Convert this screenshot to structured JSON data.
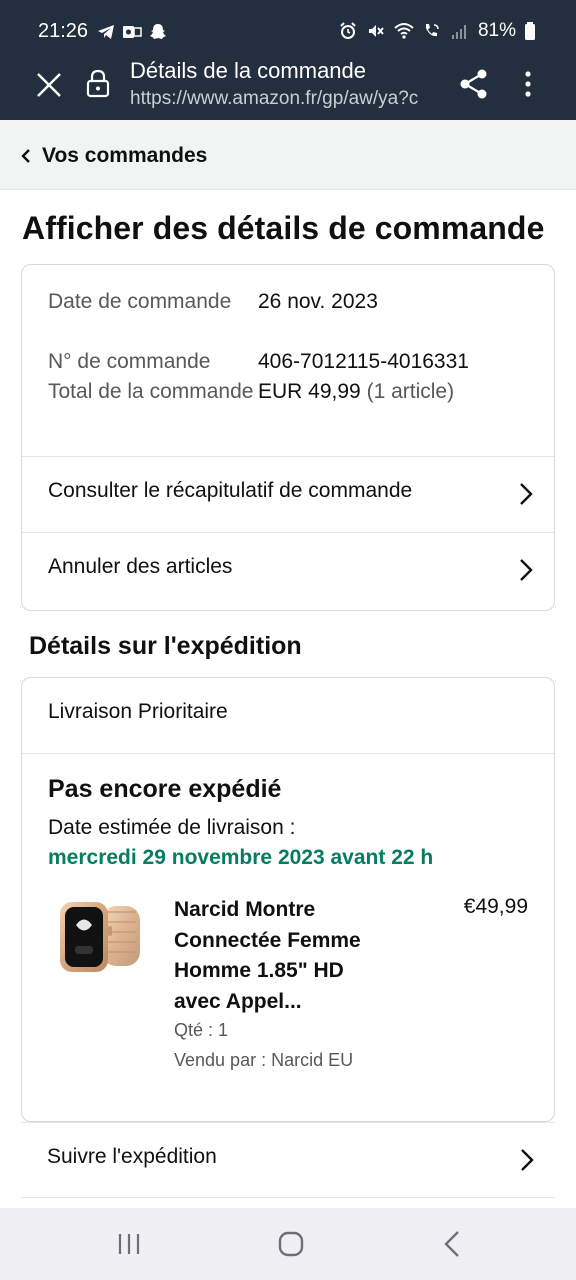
{
  "status_bar": {
    "time": "21:26",
    "battery": "81%"
  },
  "browser": {
    "title": "Détails de la commande",
    "url": "https://www.amazon.fr/gp/aw/ya?c"
  },
  "back_nav": {
    "label": "Vos commandes"
  },
  "page_title": "Afficher des détails de commande",
  "order_info": {
    "date_label": "Date de commande",
    "date_value": "26 nov. 2023",
    "number_label": "N° de commande",
    "number_value": "406-7012115-4016331",
    "total_label": "Total de la commande",
    "total_value": "EUR 49,99",
    "total_count": "(1 article)"
  },
  "links": {
    "summary": "Consulter le récapitulatif de commande",
    "cancel": "Annuler des articles"
  },
  "shipment": {
    "section_title": "Détails sur l'expédition",
    "method": "Livraison Prioritaire",
    "status": "Pas encore expédié",
    "estimate_label": "Date estimée de livraison :",
    "estimate_date": "mercredi 29 novembre 2023 avant 22 h",
    "product": {
      "name": "Narcid Montre Connectée Femme Homme 1.85\" HD avec Appel...",
      "price": "€49,99",
      "quantity": "Qté : 1",
      "seller": "Vendu par : Narcid EU"
    },
    "track_label": "Suivre l'expédition"
  },
  "colors": {
    "header_bg": "#232f3e",
    "delivery_green": "#067d62",
    "muted_text": "#565959"
  }
}
